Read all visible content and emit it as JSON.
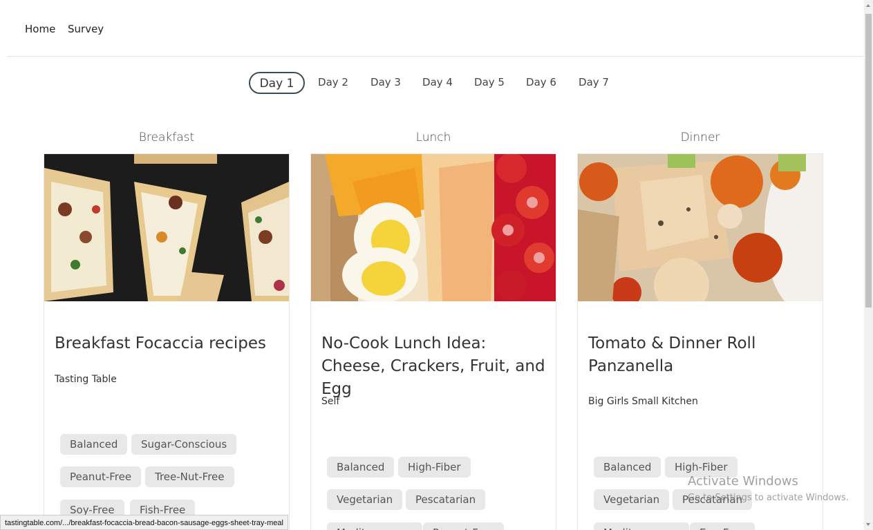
{
  "nav": {
    "home": "Home",
    "survey": "Survey"
  },
  "days": [
    "Day 1",
    "Day 2",
    "Day 3",
    "Day 4",
    "Day 5",
    "Day 6",
    "Day 7"
  ],
  "meals": [
    {
      "heading": "Breakfast",
      "title": "Breakfast Focaccia recipes",
      "source": "Tasting Table",
      "tags": [
        "Balanced",
        "Sugar-Conscious",
        "Peanut-Free",
        "Tree-Nut-Free",
        "Soy-Free",
        "Fish-Free"
      ]
    },
    {
      "heading": "Lunch",
      "title": "No-Cook Lunch Idea: Cheese, Crackers, Fruit, and Egg",
      "source": "Self",
      "tags": [
        "Balanced",
        "High-Fiber",
        "Vegetarian",
        "Pescatarian",
        "Mediterranean",
        "Peanut-Free"
      ]
    },
    {
      "heading": "Dinner",
      "title": "Tomato & Dinner Roll Panzanella",
      "source": "Big Girls Small Kitchen",
      "tags": [
        "Balanced",
        "High-Fiber",
        "Vegetarian",
        "Pescatarian",
        "Mediterranean",
        "Egg-Free"
      ]
    }
  ],
  "status_url": "tastingtable.com/.../breakfast-focaccia-bread-bacon-sausage-eggs-sheet-tray-meal",
  "watermark": {
    "line1": "Activate Windows",
    "line2": "Go to Settings to activate Windows."
  }
}
